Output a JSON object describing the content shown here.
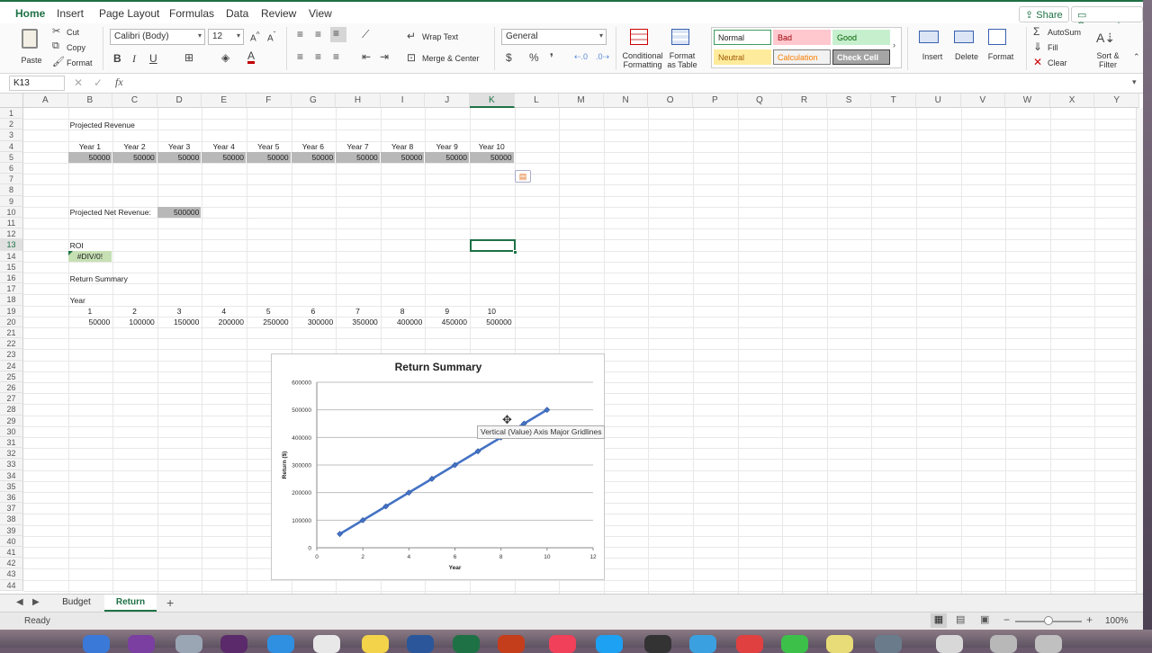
{
  "ribbon_tabs": [
    "Home",
    "Insert",
    "Page Layout",
    "Formulas",
    "Data",
    "Review",
    "View"
  ],
  "share_label": "Share",
  "comments_label": "Comments",
  "clipboard": {
    "paste": "Paste",
    "cut": "Cut",
    "copy": "Copy",
    "format": "Format"
  },
  "font": {
    "name": "Calibri (Body)",
    "size": "12"
  },
  "alignment": {
    "wrap": "Wrap Text",
    "merge": "Merge & Center"
  },
  "number_format": "General",
  "ribbon_buttons": {
    "conditional": [
      "Conditional",
      "Formatting"
    ],
    "format_table": [
      "Format",
      "as Table"
    ],
    "insert": "Insert",
    "delete": "Delete",
    "format": "Format",
    "autosum": "AutoSum",
    "fill": "Fill",
    "clear": "Clear",
    "sort": [
      "Sort &",
      "Filter"
    ]
  },
  "cell_styles": [
    {
      "label": "Normal",
      "bg": "#ffffff",
      "fg": "#222222",
      "border": "#3d9b5e"
    },
    {
      "label": "Bad",
      "bg": "#ffc7ce",
      "fg": "#9c0006",
      "border": "#ffc7ce"
    },
    {
      "label": "Good",
      "bg": "#c6efce",
      "fg": "#006100",
      "border": "#c6efce"
    },
    {
      "label": "Neutral",
      "bg": "#ffeb9c",
      "fg": "#9c5700",
      "border": "#ffeb9c"
    },
    {
      "label": "Calculation",
      "bg": "#f2f2f2",
      "fg": "#fa7d00",
      "border": "#7f7f7f"
    },
    {
      "label": "Check Cell",
      "bg": "#a5a5a5",
      "fg": "#ffffff",
      "border": "#3f3f3f"
    }
  ],
  "name_box": "K13",
  "formula_fx": "fx",
  "columns": [
    "A",
    "B",
    "C",
    "D",
    "E",
    "F",
    "G",
    "H",
    "I",
    "J",
    "K",
    "L",
    "M",
    "N",
    "O",
    "P",
    "Q",
    "R",
    "S",
    "T",
    "U",
    "V",
    "W",
    "X",
    "Y"
  ],
  "selected_column": "K",
  "selected_row": 13,
  "sheet": {
    "b2": "Projected Revenue",
    "year_headers": [
      "Year 1",
      "Year 2",
      "Year 3",
      "Year 4",
      "Year 5",
      "Year 6",
      "Year 7",
      "Year 8",
      "Year 9",
      "Year 10"
    ],
    "revenue_values": [
      "50000",
      "50000",
      "50000",
      "50000",
      "50000",
      "50000",
      "50000",
      "50000",
      "50000",
      "50000"
    ],
    "net_label": "Projected Net Revenue:",
    "net_value": "500000",
    "roi_label": "ROI",
    "roi_value": "#DIV/0!",
    "summary_label": "Return Summary",
    "year_label": "Year",
    "year_numbers": [
      "1",
      "2",
      "3",
      "4",
      "5",
      "6",
      "7",
      "8",
      "9",
      "10"
    ],
    "return_values": [
      "50000",
      "100000",
      "150000",
      "200000",
      "250000",
      "300000",
      "350000",
      "400000",
      "450000",
      "500000"
    ]
  },
  "tooltip": "Vertical (Value) Axis Major Gridlines",
  "sheet_tabs": [
    "Budget",
    "Return"
  ],
  "active_sheet": "Return",
  "status": {
    "ready": "Ready",
    "zoom": "100%"
  },
  "chart_data": {
    "type": "scatter",
    "title": "Return Summary",
    "xlabel": "Year",
    "ylabel": "Return ($)",
    "x": [
      1,
      2,
      3,
      4,
      5,
      6,
      7,
      8,
      9,
      10
    ],
    "series": [
      {
        "values": [
          50000,
          100000,
          150000,
          200000,
          250000,
          300000,
          350000,
          400000,
          450000,
          500000
        ]
      }
    ],
    "xlim": [
      0,
      12
    ],
    "ylim": [
      0,
      600000
    ],
    "xticks": [
      "0",
      "2",
      "4",
      "6",
      "8",
      "10",
      "12"
    ],
    "yticks": [
      "0",
      "100000",
      "200000",
      "300000",
      "400000",
      "500000",
      "600000"
    ],
    "line_color": "#4472c4",
    "grid": true
  }
}
